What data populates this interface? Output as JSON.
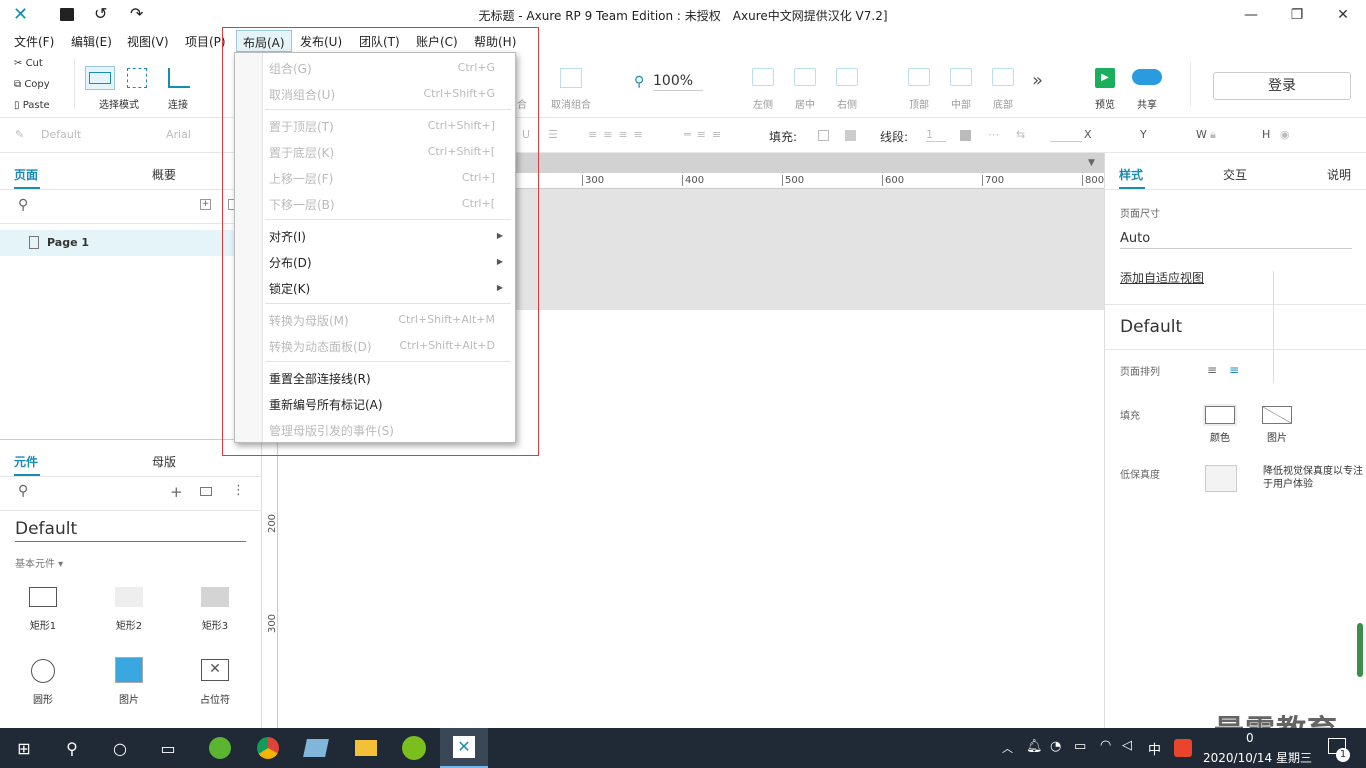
{
  "window": {
    "title": "无标题 - Axure RP 9 Team Edition : 未授权　Axure中文网提供汉化 V7.2]",
    "min": "—",
    "max": "❐",
    "close": "✕"
  },
  "menus": [
    "文件(F)",
    "编辑(E)",
    "视图(V)",
    "项目(P)",
    "布局(A)",
    "发布(U)",
    "团队(T)",
    "账户(C)",
    "帮助(H)"
  ],
  "clipboard": {
    "cut": "Cut",
    "copy": "Copy",
    "paste": "Paste"
  },
  "toolbar": {
    "select_mode": "选择模式",
    "connect": "连接",
    "ungroup_partial": "组合",
    "ungroup": "取消组合",
    "zoom": "100%",
    "left": "左侧",
    "center": "居中",
    "right": "右侧",
    "top": "顶部",
    "middle": "中部",
    "bottom": "底部",
    "preview": "预览",
    "share": "共享",
    "login": "登录",
    "more": "»"
  },
  "formatbar": {
    "style": "Default",
    "font": "Arial",
    "fill": "填充:",
    "stroke": "线段:",
    "stroke_val": "1",
    "x": "X",
    "y": "Y",
    "w": "W",
    "h": "H"
  },
  "pages_panel": {
    "tab_pages": "页面",
    "tab_outline": "概要",
    "page1": "Page 1"
  },
  "widgets_panel": {
    "tab_widgets": "元件",
    "tab_masters": "母版",
    "library": "Default",
    "category": "基本元件 ▾",
    "items": [
      "矩形1",
      "矩形2",
      "矩形3",
      "圆形",
      "图片",
      "占位符"
    ]
  },
  "ruler": {
    "h": [
      "300",
      "400",
      "500",
      "600",
      "700",
      "800"
    ],
    "v": [
      "200",
      "300"
    ]
  },
  "right_panel": {
    "tab_style": "样式",
    "tab_interact": "交互",
    "tab_notes": "说明",
    "page_size": "页面尺寸",
    "size_value": "Auto",
    "adaptive": "添加自适应视图",
    "style_name": "Default",
    "arrangement": "页面排列",
    "fill": "填充",
    "color": "颜色",
    "image": "图片",
    "low_fidelity": "低保真度",
    "low_fidelity_desc": "降低视觉保真度以专注于用户体验"
  },
  "dropdown": {
    "items": [
      {
        "label": "组合(G)",
        "shortcut": "Ctrl+G",
        "disabled": true
      },
      {
        "label": "取消组合(U)",
        "shortcut": "Ctrl+Shift+G",
        "disabled": true
      },
      {
        "label": "置于顶层(T)",
        "shortcut": "Ctrl+Shift+]",
        "disabled": true
      },
      {
        "label": "置于底层(K)",
        "shortcut": "Ctrl+Shift+[",
        "disabled": true
      },
      {
        "label": "上移一层(F)",
        "shortcut": "Ctrl+]",
        "disabled": true
      },
      {
        "label": "下移一层(B)",
        "shortcut": "Ctrl+[",
        "disabled": true
      },
      {
        "label": "对齐(I)",
        "shortcut": "",
        "disabled": false
      },
      {
        "label": "分布(D)",
        "shortcut": "",
        "disabled": false
      },
      {
        "label": "锁定(K)",
        "shortcut": "",
        "disabled": false
      },
      {
        "label": "转换为母版(M)",
        "shortcut": "Ctrl+Shift+Alt+M",
        "disabled": true
      },
      {
        "label": "转换为动态面板(D)",
        "shortcut": "Ctrl+Shift+Alt+D",
        "disabled": true
      },
      {
        "label": "重置全部连接线(R)",
        "shortcut": "",
        "disabled": false
      },
      {
        "label": "重新编号所有标记(A)",
        "shortcut": "",
        "disabled": false
      },
      {
        "label": "管理母版引发的事件(S)",
        "shortcut": "",
        "disabled": true
      }
    ]
  },
  "taskbar": {
    "ime": "中",
    "date": "2020/10/14 星期三",
    "time": "0",
    "notif": "1"
  },
  "watermark": "最需教育",
  "colors": {
    "accent": "#1a8bb5",
    "highlight_box": "#e0393e",
    "selected_row": "#e5f4f9",
    "preview_green": "#1aaf5d",
    "share_blue": "#2b9be0"
  }
}
